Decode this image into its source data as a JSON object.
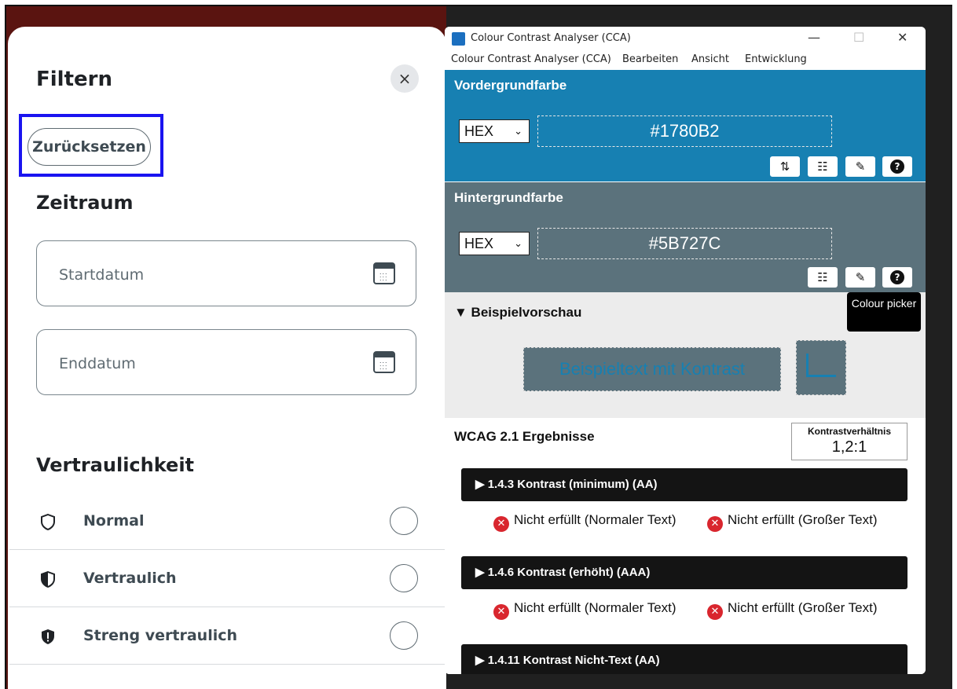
{
  "filter_panel": {
    "title": "Filtern",
    "close_icon": "×",
    "reset_label": "Zurücksetzen",
    "zeitraum_title": "Zeitraum",
    "start_placeholder": "Startdatum",
    "end_placeholder": "Enddatum",
    "confidentiality_title": "Vertraulichkeit",
    "options": [
      {
        "label": "Normal",
        "icon": "shield-outline-icon"
      },
      {
        "label": "Vertraulich",
        "icon": "shield-half-icon"
      },
      {
        "label": "Streng vertraulich",
        "icon": "shield-exclamation-icon"
      }
    ]
  },
  "cca": {
    "window_title": "Colour Contrast Analyser (CCA)",
    "window_controls": {
      "minimize": "—",
      "maximize": "☐",
      "close": "✕"
    },
    "menu": [
      "Colour Contrast Analyser (CCA)",
      "Bearbeiten",
      "Ansicht",
      "Entwicklung"
    ],
    "foreground": {
      "title": "Vordergrundfarbe",
      "format": "HEX",
      "value": "#1780B2",
      "color": "#1780b2",
      "tools": [
        "swap-icon",
        "sliders-icon",
        "eyedropper-icon",
        "help-icon"
      ]
    },
    "background": {
      "title": "Hintergrundfarbe",
      "format": "HEX",
      "value": "#5B727C",
      "color": "#5b727c",
      "tools": [
        "sliders-icon",
        "eyedropper-icon",
        "help-icon"
      ]
    },
    "preview": {
      "title": "▼ Beispielvorschau",
      "sample_text": "Beispieltext mit Kontrast",
      "tooltip": "Colour picker"
    },
    "results": {
      "title": "WCAG 2.1 Ergebnisse",
      "ratio_label": "Kontrastverhältnis",
      "ratio_value": "1,2:1",
      "criteria": [
        {
          "label": "▶ 1.4.3 Kontrast (minimum) (AA)",
          "normal": "Nicht erfüllt (Normaler Text)",
          "large": "Nicht erfüllt (Großer Text)"
        },
        {
          "label": "▶ 1.4.6 Kontrast (erhöht) (AAA)",
          "normal": "Nicht erfüllt (Normaler Text)",
          "large": "Nicht erfüllt (Großer Text)"
        },
        {
          "label": "▶ 1.4.11 Kontrast Nicht-Text (AA)"
        }
      ]
    }
  }
}
